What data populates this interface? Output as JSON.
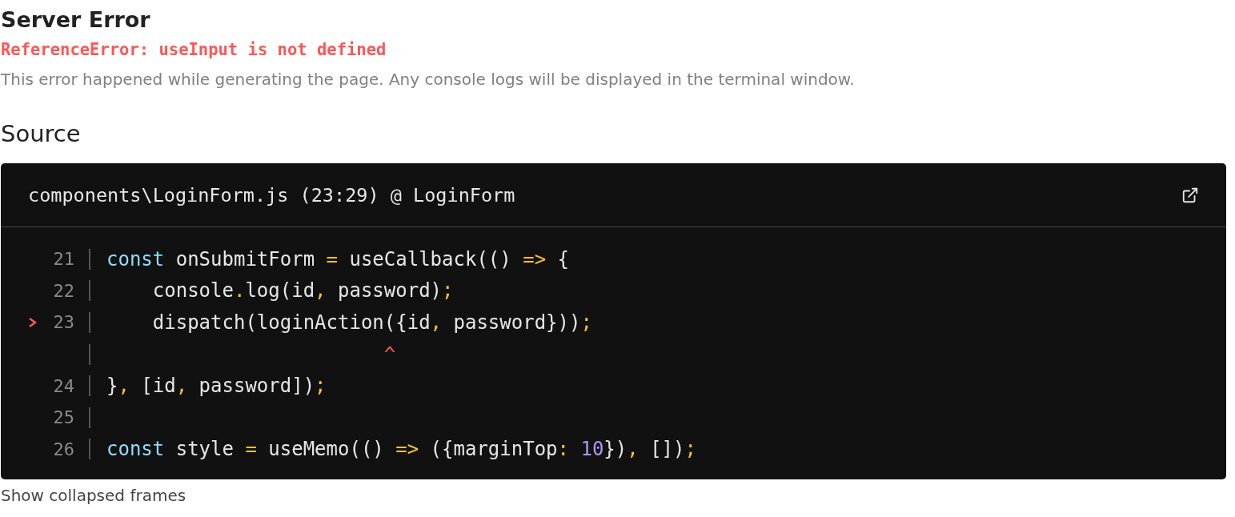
{
  "title": "Server Error",
  "error": "ReferenceError: useInput is not defined",
  "description": "This error happened while generating the page. Any console logs will be displayed in the terminal window.",
  "section_title": "Source",
  "source": {
    "location": "components\\LoginForm.js (23:29) @ LoginForm",
    "lines": [
      {
        "kind": "code",
        "number": "21",
        "current": false,
        "tokens": [
          {
            "text": "const",
            "kind": "kw"
          },
          {
            "text": " onSubmitForm ",
            "kind": "plain"
          },
          {
            "text": "=",
            "kind": "punct"
          },
          {
            "text": " useCallback(() ",
            "kind": "plain"
          },
          {
            "text": "=>",
            "kind": "punct"
          },
          {
            "text": " {",
            "kind": "plain"
          }
        ]
      },
      {
        "kind": "code",
        "number": "22",
        "current": false,
        "tokens": [
          {
            "text": "    console",
            "kind": "plain"
          },
          {
            "text": ".",
            "kind": "punct"
          },
          {
            "text": "log(id",
            "kind": "plain"
          },
          {
            "text": ",",
            "kind": "punct"
          },
          {
            "text": " password)",
            "kind": "plain"
          },
          {
            "text": ";",
            "kind": "punct"
          }
        ]
      },
      {
        "kind": "code",
        "number": "23",
        "current": true,
        "tokens": [
          {
            "text": "    dispatch(loginAction({id",
            "kind": "plain"
          },
          {
            "text": ",",
            "kind": "punct"
          },
          {
            "text": " password}))",
            "kind": "plain"
          },
          {
            "text": ";",
            "kind": "punct"
          }
        ]
      },
      {
        "kind": "pointer",
        "caret": "^"
      },
      {
        "kind": "code",
        "number": "24",
        "current": false,
        "tokens": [
          {
            "text": "}",
            "kind": "plain"
          },
          {
            "text": ",",
            "kind": "punct"
          },
          {
            "text": " [id",
            "kind": "plain"
          },
          {
            "text": ",",
            "kind": "punct"
          },
          {
            "text": " password])",
            "kind": "plain"
          },
          {
            "text": ";",
            "kind": "punct"
          }
        ]
      },
      {
        "kind": "code",
        "number": "25",
        "current": false
      },
      {
        "kind": "code",
        "number": "26",
        "current": false,
        "tokens": [
          {
            "text": "const",
            "kind": "kw"
          },
          {
            "text": " style ",
            "kind": "plain"
          },
          {
            "text": "=",
            "kind": "punct"
          },
          {
            "text": " useMemo(() ",
            "kind": "plain"
          },
          {
            "text": "=>",
            "kind": "punct"
          },
          {
            "text": " ({marginTop",
            "kind": "plain"
          },
          {
            "text": ": ",
            "kind": "punct"
          },
          {
            "text": "10",
            "kind": "num"
          },
          {
            "text": "})",
            "kind": "plain"
          },
          {
            "text": ",",
            "kind": "punct"
          },
          {
            "text": " [])",
            "kind": "plain"
          },
          {
            "text": ";",
            "kind": "punct"
          }
        ]
      }
    ]
  },
  "footer_link": "Show collapsed frames"
}
